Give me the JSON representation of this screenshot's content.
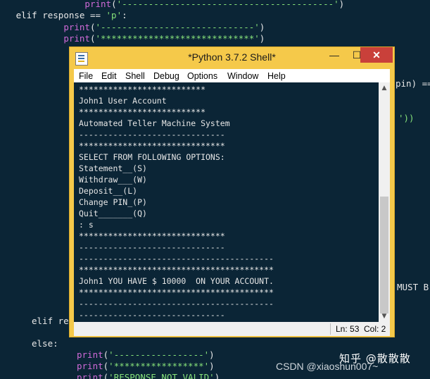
{
  "editor": {
    "lines": [
      {
        "indent": "                ",
        "fn": "print",
        "str": "'----------------------------------------'",
        "close": ")"
      },
      {
        "kw": "elif",
        "rest": " response == ",
        "str": "'p'",
        "tail": ":"
      },
      {
        "indent": "        ",
        "fn": "print",
        "str": "'-----------------------------'",
        "close": ")"
      },
      {
        "indent": "        ",
        "fn": "print",
        "str": "'*****************************'",
        "close": ")"
      }
    ],
    "frag_pin": "pin) ==",
    "frag_paren": "'))",
    "frag_must": "MUST B",
    "elif_re": "elif re",
    "else_kw": "else:",
    "bottom_lines": [
      {
        "fn": "print",
        "str": "'-----------------'",
        "close": ")"
      },
      {
        "fn": "print",
        "str": "'*****************'",
        "close": ")"
      },
      {
        "fn": "print",
        "str": "'RESPONSE NOT VALID'",
        "close": ")"
      }
    ]
  },
  "window": {
    "title": "*Python 3.7.2 Shell*",
    "min": "—",
    "max": "☐",
    "close": "✕"
  },
  "menu": [
    "File",
    "Edit",
    "Shell",
    "Debug",
    "Options",
    "Window",
    "Help"
  ],
  "shell_lines": [
    "**************************",
    "John1 User Account",
    "**************************",
    "Automated Teller Machine System",
    "------------------------------",
    "******************************",
    "SELECT FROM FOLLOWING OPTIONS:",
    "Statement__(S)",
    "Withdraw___(W)",
    "Deposit__(L)",
    "Change PIN_(P)",
    "Quit_______(Q)",
    ": s",
    "******************************",
    "------------------------------",
    "----------------------------------------",
    "****************************************",
    "John1 YOU HAVE $ 10000  ON YOUR ACCOUNT.",
    "****************************************",
    "----------------------------------------",
    "------------------------------",
    "******************************"
  ],
  "status": {
    "ln": "Ln: 53",
    "col": "Col: 2"
  },
  "watermark": {
    "zh": "知乎 @散散散",
    "csdn": "CSDN @xiaoshun007~"
  },
  "colors": {
    "titlebar": "#f5c94a",
    "shell_bg": "#0b2536",
    "close_btn": "#c9403a",
    "string": "#86e27a",
    "builtin": "#d06ad8"
  }
}
